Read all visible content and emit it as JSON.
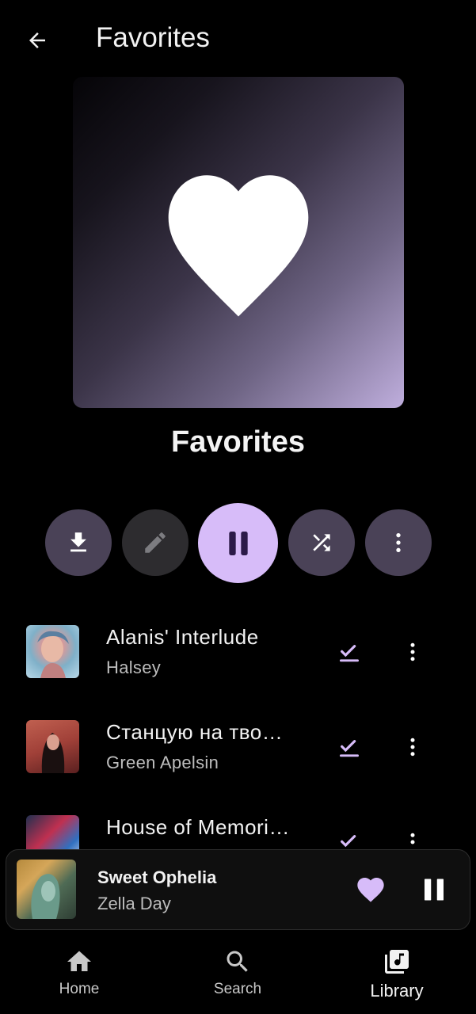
{
  "header": {
    "title": "Favorites",
    "back_icon": "arrow-left-icon"
  },
  "playlist": {
    "title": "Favorites",
    "cover_icon": "heart-icon",
    "accent_color": "#d7bcf9"
  },
  "actions": [
    {
      "name": "download-button",
      "icon": "download-icon"
    },
    {
      "name": "edit-button",
      "icon": "pencil-icon"
    },
    {
      "name": "pause-button",
      "icon": "pause-icon"
    },
    {
      "name": "shuffle-button",
      "icon": "shuffle-icon"
    },
    {
      "name": "more-button",
      "icon": "more-vert-icon"
    }
  ],
  "songs": [
    {
      "title": "Alanis' Interlude",
      "artist": "Halsey"
    },
    {
      "title": "Станцую на тво…",
      "artist": "Green Apelsin"
    },
    {
      "title": "House of Memori…",
      "artist": ""
    }
  ],
  "now_playing": {
    "title": "Sweet Ophelia",
    "artist": "Zella Day",
    "liked": true
  },
  "nav": [
    {
      "label": "Home",
      "icon": "home-icon",
      "active": false
    },
    {
      "label": "Search",
      "icon": "search-icon",
      "active": false
    },
    {
      "label": "Library",
      "icon": "library-music-icon",
      "active": true
    }
  ]
}
